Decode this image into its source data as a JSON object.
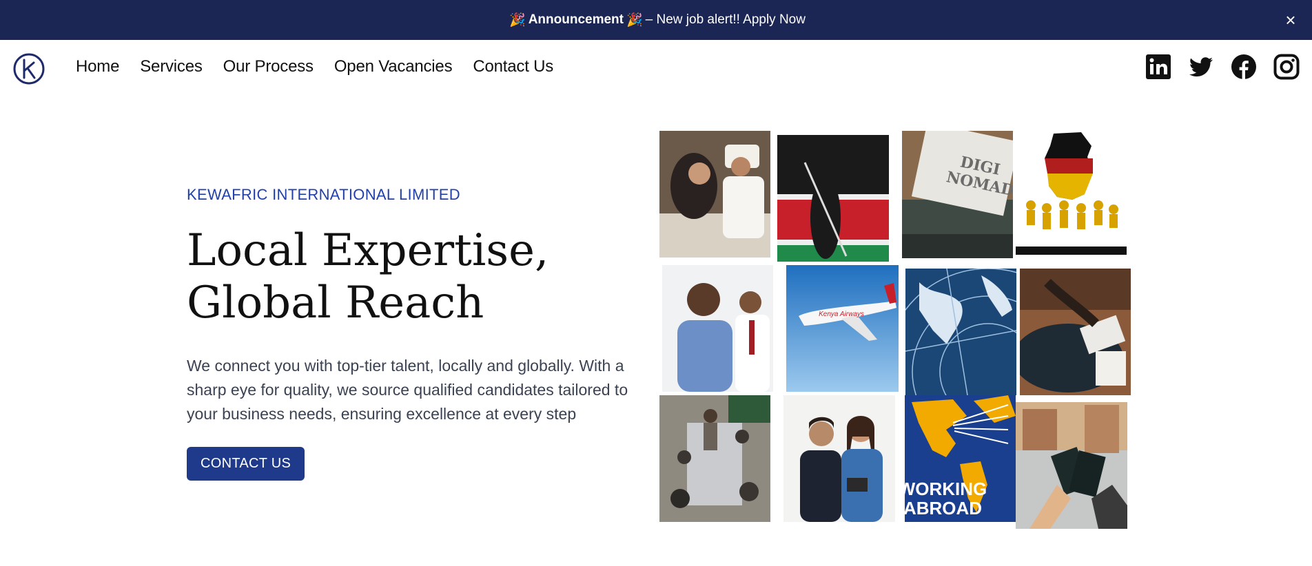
{
  "announcement": {
    "emoji": "🎉",
    "bold": "Announcement",
    "text": "– New job alert!! Apply Now",
    "close_label": "×"
  },
  "nav": {
    "items": [
      "Home",
      "Services",
      "Our Process",
      "Open Vacancies",
      "Contact Us"
    ],
    "socials": [
      "linkedin-icon",
      "twitter-icon",
      "facebook-icon",
      "instagram-icon"
    ]
  },
  "hero": {
    "kicker": "KEWAFRIC INTERNATIONAL LIMITED",
    "headline_line1": "Local Expertise,",
    "headline_line2": "Global Reach",
    "description": "We connect you with top-tier talent, locally and globally. With a sharp eye for quality, we source qualified candidates tailored to your business needs, ensuring excellence at every step",
    "cta_label": "CONTACT US"
  },
  "gallery": {
    "typewriter_text_1": "DIGI",
    "typewriter_text_2": "NOMAD",
    "airline_text": "Kenya Airways",
    "working_abroad_1": "WORKING",
    "working_abroad_2": "ABROAD"
  },
  "colors": {
    "announcement_bg": "#1b2655",
    "brand_blue": "#1f3a8a",
    "kicker_blue": "#2340a8"
  }
}
